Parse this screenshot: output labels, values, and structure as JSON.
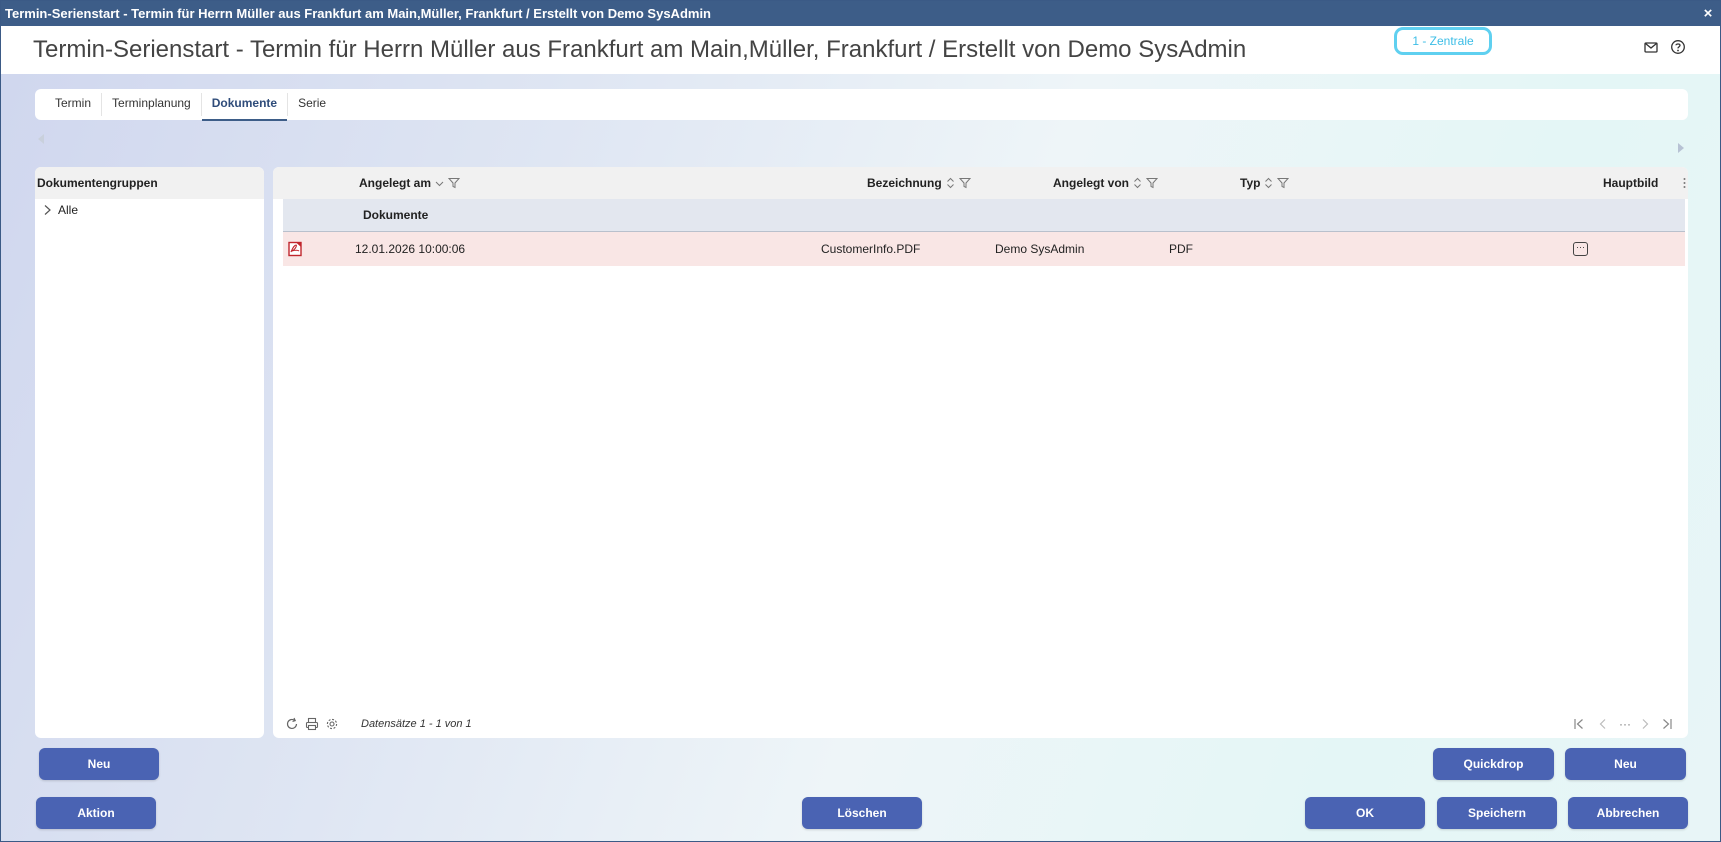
{
  "window": {
    "title": "Termin-Serienstart - Termin für Herrn Müller aus Frankfurt am Main,Müller, Frankfurt / Erstellt von Demo SysAdmin",
    "close_label": "×"
  },
  "header": {
    "title": "Termin-Serienstart - Termin für Herrn Müller aus Frankfurt am Main,Müller, Frankfurt / Erstellt von Demo SysAdmin",
    "branch": "1 - Zentrale"
  },
  "tabs": [
    {
      "label": "Termin"
    },
    {
      "label": "Terminplanung"
    },
    {
      "label": "Dokumente",
      "active": true
    },
    {
      "label": "Serie"
    }
  ],
  "groups": {
    "header": "Dokumentengruppen",
    "items": [
      {
        "label": "Alle"
      }
    ]
  },
  "grid": {
    "columns": {
      "created_at": "Angelegt am",
      "name": "Bezeichnung",
      "created_by": "Angelegt von",
      "type": "Typ",
      "main_image": "Hauptbild"
    },
    "group_label": "Dokumente",
    "rows": [
      {
        "created_at": "12.01.2026 10:00:06",
        "name": "CustomerInfo.PDF",
        "created_by": "Demo SysAdmin",
        "type": "PDF"
      }
    ],
    "records_text": "Datensätze 1 - 1 von 1",
    "pager_ellipsis": "···"
  },
  "buttons": {
    "groups_new": "Neu",
    "quickdrop": "Quickdrop",
    "grid_new": "Neu",
    "action": "Aktion",
    "delete": "Löschen",
    "ok": "OK",
    "save": "Speichern",
    "cancel": "Abbrechen"
  },
  "colors": {
    "titlebar": "#3d5d88",
    "button": "#4a63b3",
    "badge": "#5fd0f0",
    "row_highlight": "#f9e6e5"
  }
}
